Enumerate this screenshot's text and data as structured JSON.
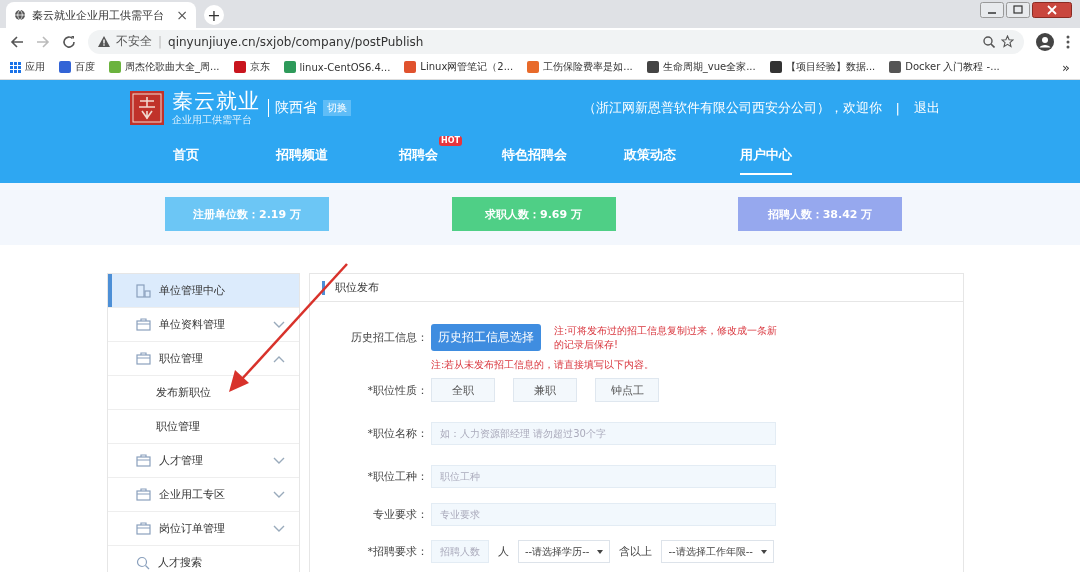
{
  "browser": {
    "tab_title": "秦云就业企业用工供需平台",
    "tab_close": "×",
    "new_tab": "+",
    "security": "不安全",
    "security_separator": "|",
    "url": "qinyunjiuye.cn/sxjob/company/postPublish",
    "bookmarks": [
      {
        "kind": "apps",
        "label": "应用",
        "color": "#1a73e8"
      },
      {
        "kind": "site",
        "label": "百度",
        "color": "#3264d6"
      },
      {
        "kind": "site",
        "label": "周杰伦歌曲大全_周...",
        "color": "#6bb33e"
      },
      {
        "kind": "site",
        "label": "京东",
        "color": "#c9151e"
      },
      {
        "kind": "site",
        "label": "linux-CentOS6.4...",
        "color": "#2e9a5a"
      },
      {
        "kind": "site",
        "label": "Linux网管笔记（2...",
        "color": "#e0522e"
      },
      {
        "kind": "site",
        "label": "工伤保险费率是如...",
        "color": "#e86a2a"
      },
      {
        "kind": "site",
        "label": "生命周期_vue全家...",
        "color": "#444444"
      },
      {
        "kind": "site",
        "label": "【项目经验】数据...",
        "color": "#333333"
      },
      {
        "kind": "site",
        "label": "Docker 入门教程 -...",
        "color": "#555555"
      }
    ],
    "more": "»"
  },
  "header": {
    "brand": "秦云就业",
    "slogan": "企业用工供需平台",
    "province": "陕西省",
    "switch": "切换",
    "welcome": "（浙江网新恩普软件有限公司西安分公司），欢迎你",
    "separator": "|",
    "logout": "退出",
    "nav": [
      {
        "label": "首页",
        "selected": false
      },
      {
        "label": "招聘频道",
        "selected": false
      },
      {
        "label": "招聘会",
        "selected": false,
        "badge": "HOT"
      },
      {
        "label": "特色招聘会",
        "selected": false
      },
      {
        "label": "政策动态",
        "selected": false
      },
      {
        "label": "用户中心",
        "selected": true
      }
    ]
  },
  "stats": [
    {
      "label": "注册单位数：2.19 万",
      "color": "#6cc6f5"
    },
    {
      "label": "求职人数：9.69 万",
      "color": "#4fcf86"
    },
    {
      "label": "招聘人数：38.42 万",
      "color": "#96a8ee"
    }
  ],
  "sidebar": [
    {
      "label": "单位管理中心",
      "kind": "home",
      "selected": true
    },
    {
      "label": "单位资料管理",
      "kind": "group",
      "selected": false,
      "expanded": false
    },
    {
      "label": "职位管理",
      "kind": "group",
      "selected": false,
      "expanded": true,
      "children": [
        {
          "label": "发布新职位",
          "selected": false
        },
        {
          "label": "职位管理",
          "selected": false
        }
      ]
    },
    {
      "label": "人才管理",
      "kind": "group",
      "selected": false,
      "expanded": false
    },
    {
      "label": "企业用工专区",
      "kind": "group",
      "selected": false,
      "expanded": false
    },
    {
      "label": "岗位订单管理",
      "kind": "group",
      "selected": false,
      "expanded": false
    },
    {
      "label": "人才搜索",
      "kind": "search",
      "selected": false
    }
  ],
  "panel": {
    "title": "职位发布",
    "history": {
      "label": "历史招工信息：",
      "button": "历史招工信息选择",
      "note": "注:可将发布过的招工信息复制过来，修改成一条新的记录后保存!"
    },
    "note": "注:若从未发布招工信息的，请直接填写以下内容。",
    "nature": {
      "label": "*职位性质：",
      "options": [
        {
          "label": "全职",
          "selected": false
        },
        {
          "label": "兼职",
          "selected": false
        },
        {
          "label": "钟点工",
          "selected": false
        }
      ]
    },
    "fields": [
      {
        "label": "*职位名称：",
        "placeholder": "如：人力资源部经理 请勿超过30个字"
      },
      {
        "label": "*职位工种：",
        "placeholder": "职位工种"
      },
      {
        "label": "专业要求：",
        "placeholder": "专业要求"
      }
    ],
    "requirement": {
      "label": "*招聘要求：",
      "count_placeholder": "招聘人数",
      "unit": "人",
      "education": "--请选择学历--",
      "suffix": "含以上",
      "years": "--请选择工作年限--"
    }
  }
}
